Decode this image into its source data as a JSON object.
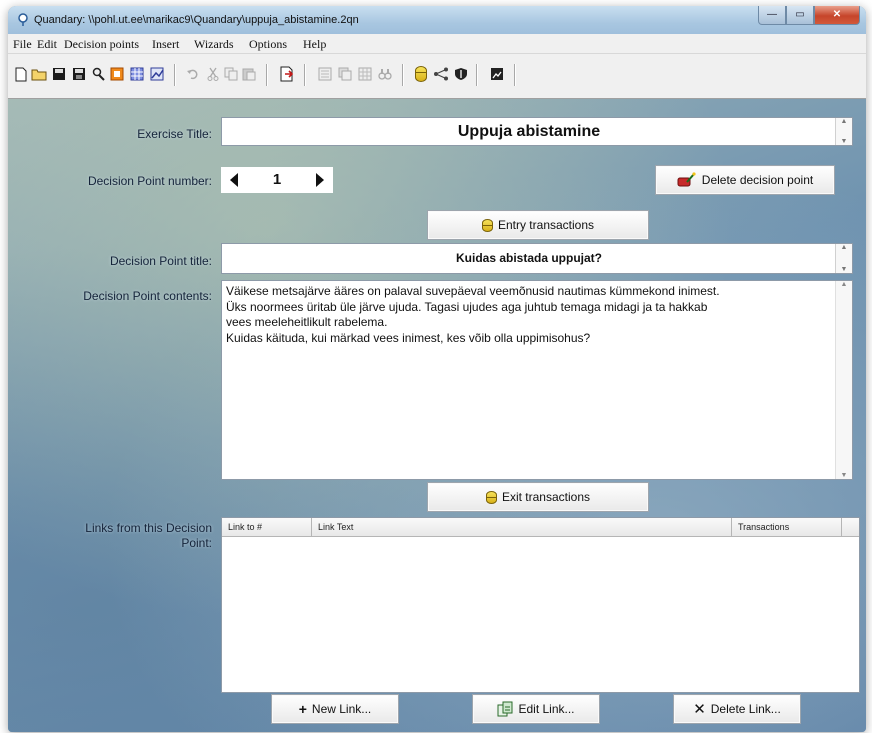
{
  "window": {
    "title": "Quandary: \\\\pohl.ut.ee\\marikac9\\Quandary\\uppuja_abistamine.2qn",
    "buttons": {
      "minimize": "—",
      "maximize": "▭",
      "close": "✕"
    }
  },
  "menu": [
    "File",
    "Edit",
    "Decision points",
    "Insert",
    "Wizards",
    "Options",
    "Help"
  ],
  "toolbar_icons": [
    "new-file-icon",
    "open-folder-icon",
    "save-icon",
    "save-as-icon",
    "find-icon",
    "stop-icon",
    "grid-icon",
    "chart-icon",
    "undo-icon",
    "cut-icon",
    "copy-icon",
    "paste-icon",
    "export-icon",
    "page-icon",
    "copy-pages-icon",
    "table-icon",
    "binoculars-icon",
    "database-icon",
    "share-icon",
    "shield-icon",
    "image-icon"
  ],
  "exercise": {
    "label": "Exercise Title:",
    "title": "Uppuja abistamine"
  },
  "decision_point": {
    "number_label": "Decision Point number:",
    "number": "1",
    "delete_button": "Delete decision point",
    "entry_button": "Entry transactions",
    "title_label": "Decision Point title:",
    "title": "Kuidas abistada uppujat?",
    "contents_label": "Decision Point contents:",
    "contents": [
      "Väikese metsajärve ääres on palaval suvepäeval veemõnusid nautimas kümmekond inimest.",
      "Üks noormees üritab üle järve ujuda. Tagasi ujudes aga juhtub temaga midagi ja ta hakkab",
      "vees meeleheitlikult rabelema.",
      "Kuidas käituda, kui märkad vees inimest, kes võib olla uppimisohus?"
    ],
    "exit_button": "Exit transactions"
  },
  "links": {
    "label_line1": "Links from this Decision",
    "label_line2": "Point:",
    "columns": [
      "Link to #",
      "Link Text",
      "Transactions"
    ],
    "rows": []
  },
  "buttons": {
    "new_link": "New Link...",
    "edit_link": "Edit Link...",
    "delete_link": "Delete Link..."
  },
  "colors": {
    "titlebar": "#a9c7e1",
    "background": "#6f93b0",
    "coin": "#e8c935"
  }
}
